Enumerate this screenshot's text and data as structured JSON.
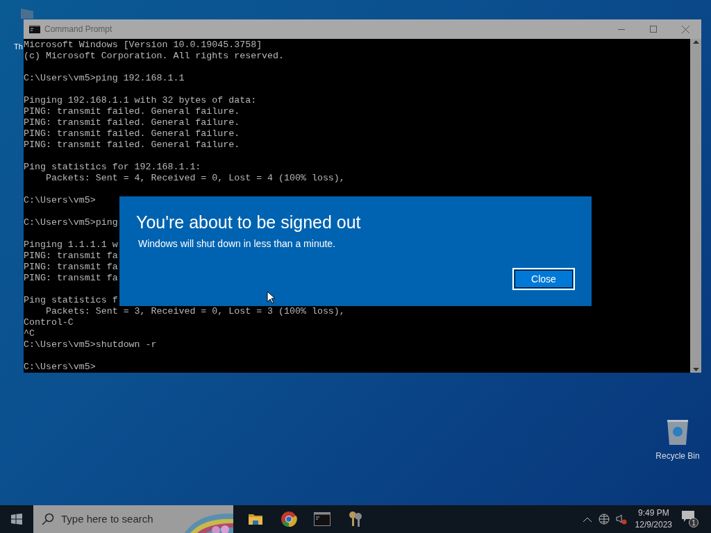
{
  "desktop": {
    "icons": [
      {
        "label": "Th",
        "kind": "partial"
      },
      {
        "label": "Recycle Bin",
        "kind": "recycle"
      }
    ]
  },
  "window": {
    "title": "Command Prompt",
    "blocks": [
      [
        "Microsoft Windows [Version 10.0.19045.3758]",
        "(c) Microsoft Corporation. All rights reserved."
      ],
      [
        "C:\\Users\\vm5>ping 192.168.1.1"
      ],
      [
        "Pinging 192.168.1.1 with 32 bytes of data:",
        "PING: transmit failed. General failure.",
        "PING: transmit failed. General failure.",
        "PING: transmit failed. General failure.",
        "PING: transmit failed. General failure."
      ],
      [
        "Ping statistics for 192.168.1.1:",
        "    Packets: Sent = 4, Received = 0, Lost = 4 (100% loss),"
      ],
      [
        "C:\\Users\\vm5>"
      ],
      [
        "C:\\Users\\vm5>ping"
      ],
      [
        "Pinging 1.1.1.1 w",
        "PING: transmit fa",
        "PING: transmit fa",
        "PING: transmit fa"
      ],
      [
        "Ping statistics f",
        "    Packets: Sent = 3, Received = 0, Lost = 3 (100% loss),",
        "Control-C",
        "^C",
        "C:\\Users\\vm5>shutdown -r"
      ],
      [
        "C:\\Users\\vm5>"
      ]
    ]
  },
  "dialog": {
    "title": "You're about to be signed out",
    "message": "Windows will shut down in less than a minute.",
    "button": "Close"
  },
  "taskbar": {
    "search_placeholder": "Type here to search",
    "apps": [
      {
        "kind": "folder"
      },
      {
        "kind": "chrome"
      },
      {
        "kind": "cmd"
      },
      {
        "kind": "keys"
      }
    ],
    "time": "9:49 PM",
    "date": "12/9/2023",
    "notifications": "1"
  }
}
